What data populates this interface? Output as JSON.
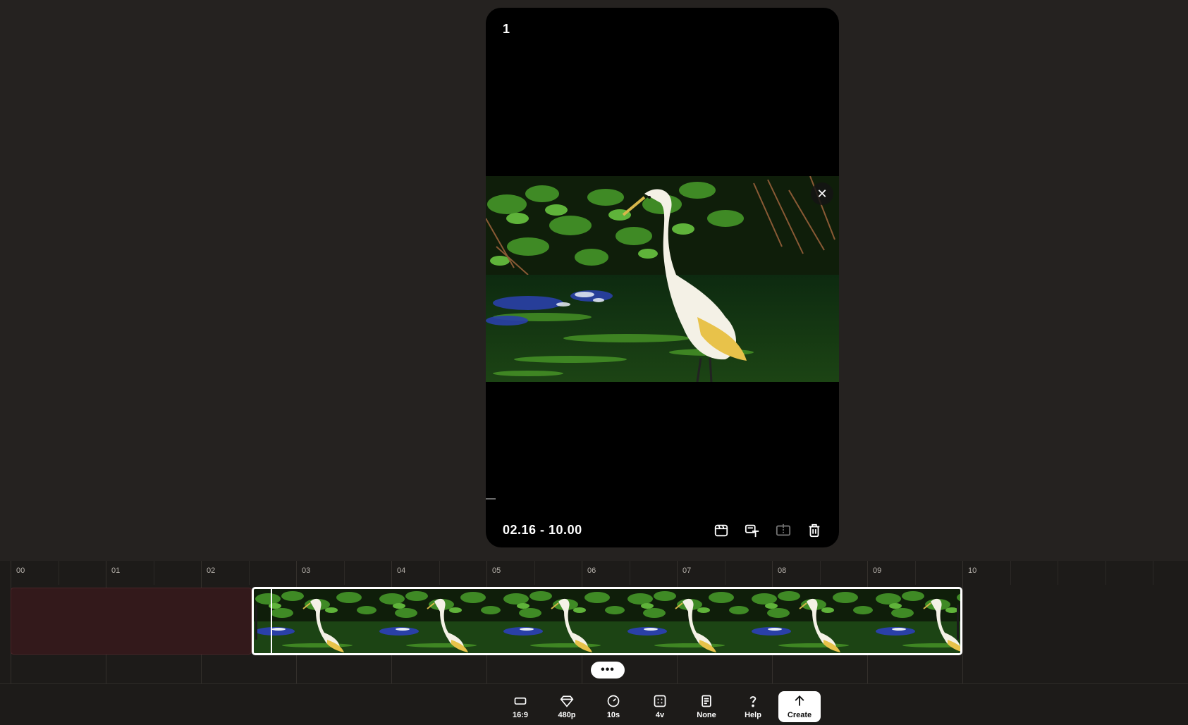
{
  "preview": {
    "clip_index": "1",
    "time_range": "02.16 - 10.00",
    "close_symbol": "✕",
    "actions": [
      {
        "name": "clip-icon",
        "disabled": false
      },
      {
        "name": "text-overlay-icon",
        "disabled": false
      },
      {
        "name": "split-icon",
        "disabled": true
      },
      {
        "name": "trash-icon",
        "disabled": false
      }
    ]
  },
  "timeline": {
    "ticks": [
      "00",
      "01",
      "02",
      "03",
      "04",
      "05",
      "06",
      "07",
      "08",
      "09",
      "10"
    ],
    "more_label": "•••"
  },
  "toolbar": {
    "items": [
      {
        "icon": "aspect-ratio-icon",
        "label": "16:9"
      },
      {
        "icon": "diamond-icon",
        "label": "480p"
      },
      {
        "icon": "duration-icon",
        "label": "10s"
      },
      {
        "icon": "variations-icon",
        "label": "4v"
      },
      {
        "icon": "preset-icon",
        "label": "None"
      },
      {
        "icon": "help-icon",
        "label": "Help"
      }
    ],
    "create_label": "Create"
  },
  "colors": {
    "background": "#252220",
    "card": "#000000",
    "timeline": "#1d1b19",
    "empty_region": "#33191b",
    "accent": "#ffffff"
  }
}
